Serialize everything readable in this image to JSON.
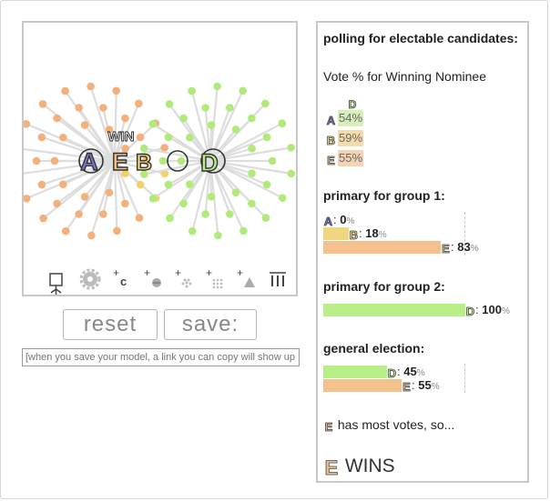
{
  "colors": {
    "A": "#7777cc",
    "B": "#f0d67e",
    "C": "#f4c2a0",
    "D": "#b8ef86",
    "E": "#f4c08c",
    "edge": "#dddddd",
    "border": "#c8c8c8"
  },
  "simulation": {
    "win_label": "WIN",
    "candidates": [
      "A",
      "E",
      "B",
      "D"
    ]
  },
  "toolbar": {
    "tools": [
      {
        "name": "voter-tool-icon"
      },
      {
        "name": "gear-icon"
      },
      {
        "name": "add-candidate-icon",
        "text": "c"
      },
      {
        "name": "add-voter-icon"
      },
      {
        "name": "add-crowd-icon"
      },
      {
        "name": "add-grid-icon"
      },
      {
        "name": "add-triangle-icon"
      },
      {
        "name": "bars-icon"
      }
    ]
  },
  "buttons": {
    "reset_label": "reset",
    "save_label": "save:"
  },
  "link_field": {
    "placeholder": "[when you save your model, a link you can copy will show up here]"
  },
  "panel": {
    "title": "polling for electable candidates:",
    "subtitle": "Vote % for Winning Nominee",
    "poll": {
      "head": "D",
      "rows": [
        {
          "candidate": "A",
          "value": "54%",
          "color": "#d7f0b9"
        },
        {
          "candidate": "B",
          "value": "59%",
          "color": "#f4dcaa"
        },
        {
          "candidate": "E",
          "value": "55%",
          "color": "#f4d4b2"
        }
      ]
    },
    "primary1": {
      "title": "primary for group 1:",
      "rows": [
        {
          "candidate": "A",
          "value": "0",
          "pct": "%",
          "share": 0
        },
        {
          "candidate": "B",
          "value": "18",
          "pct": "%",
          "share": 18
        },
        {
          "candidate": "E",
          "value": "83",
          "pct": "%",
          "share": 83
        }
      ]
    },
    "primary2": {
      "title": "primary for group 2:",
      "rows": [
        {
          "candidate": "D",
          "value": "100",
          "pct": "%",
          "share": 100
        }
      ]
    },
    "general": {
      "title": "general election:",
      "rows": [
        {
          "candidate": "D",
          "value": "45",
          "pct": "%",
          "share": 45
        },
        {
          "candidate": "E",
          "value": "55",
          "pct": "%",
          "share": 55
        }
      ]
    },
    "most_votes": "has most votes, so...",
    "most_candidate": "E",
    "winner_candidate": "E",
    "winner_text": "WINS"
  }
}
